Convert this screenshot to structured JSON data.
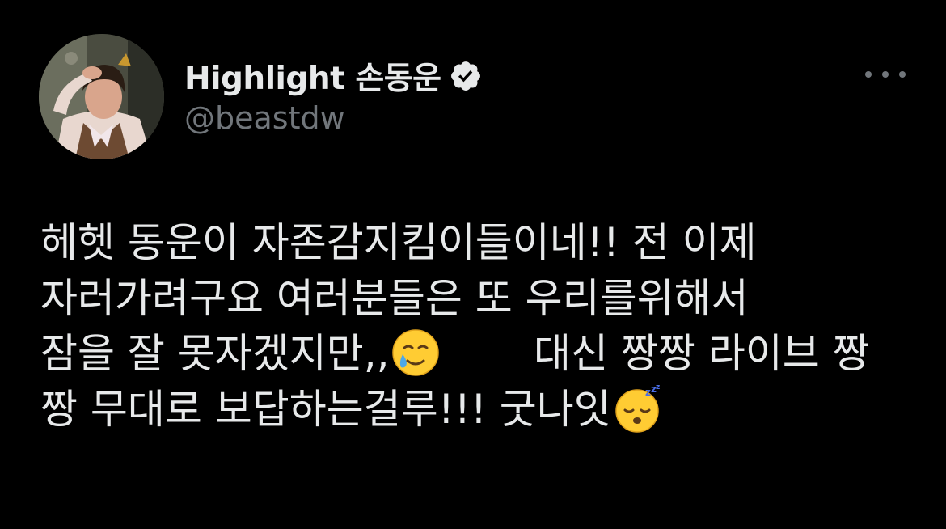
{
  "author": {
    "display_name": "Highlight 손동운",
    "handle": "@beastdw",
    "verified": true,
    "verified_icon": "verified-badge-icon",
    "avatar": "profile-photo"
  },
  "menu": {
    "icon": "more-options-icon"
  },
  "tweet": {
    "lines": [
      "헤헷 동운이 자존감지킴이들이네!! 전 이제",
      "자러가려구요 여러분들은 또 우리를위해서",
      "잠을 잘 못자겠지만,,",
      "대신 짱짱 라이브 짱",
      "짱 무대로 보답하는걸루!!! 굿나잇"
    ],
    "emojis": [
      "smiling-face-with-tear-emoji",
      "sleeping-face-emoji"
    ]
  },
  "colors": {
    "background": "#000000",
    "primary_text": "#e7e9ea",
    "secondary_text": "#71767b"
  }
}
